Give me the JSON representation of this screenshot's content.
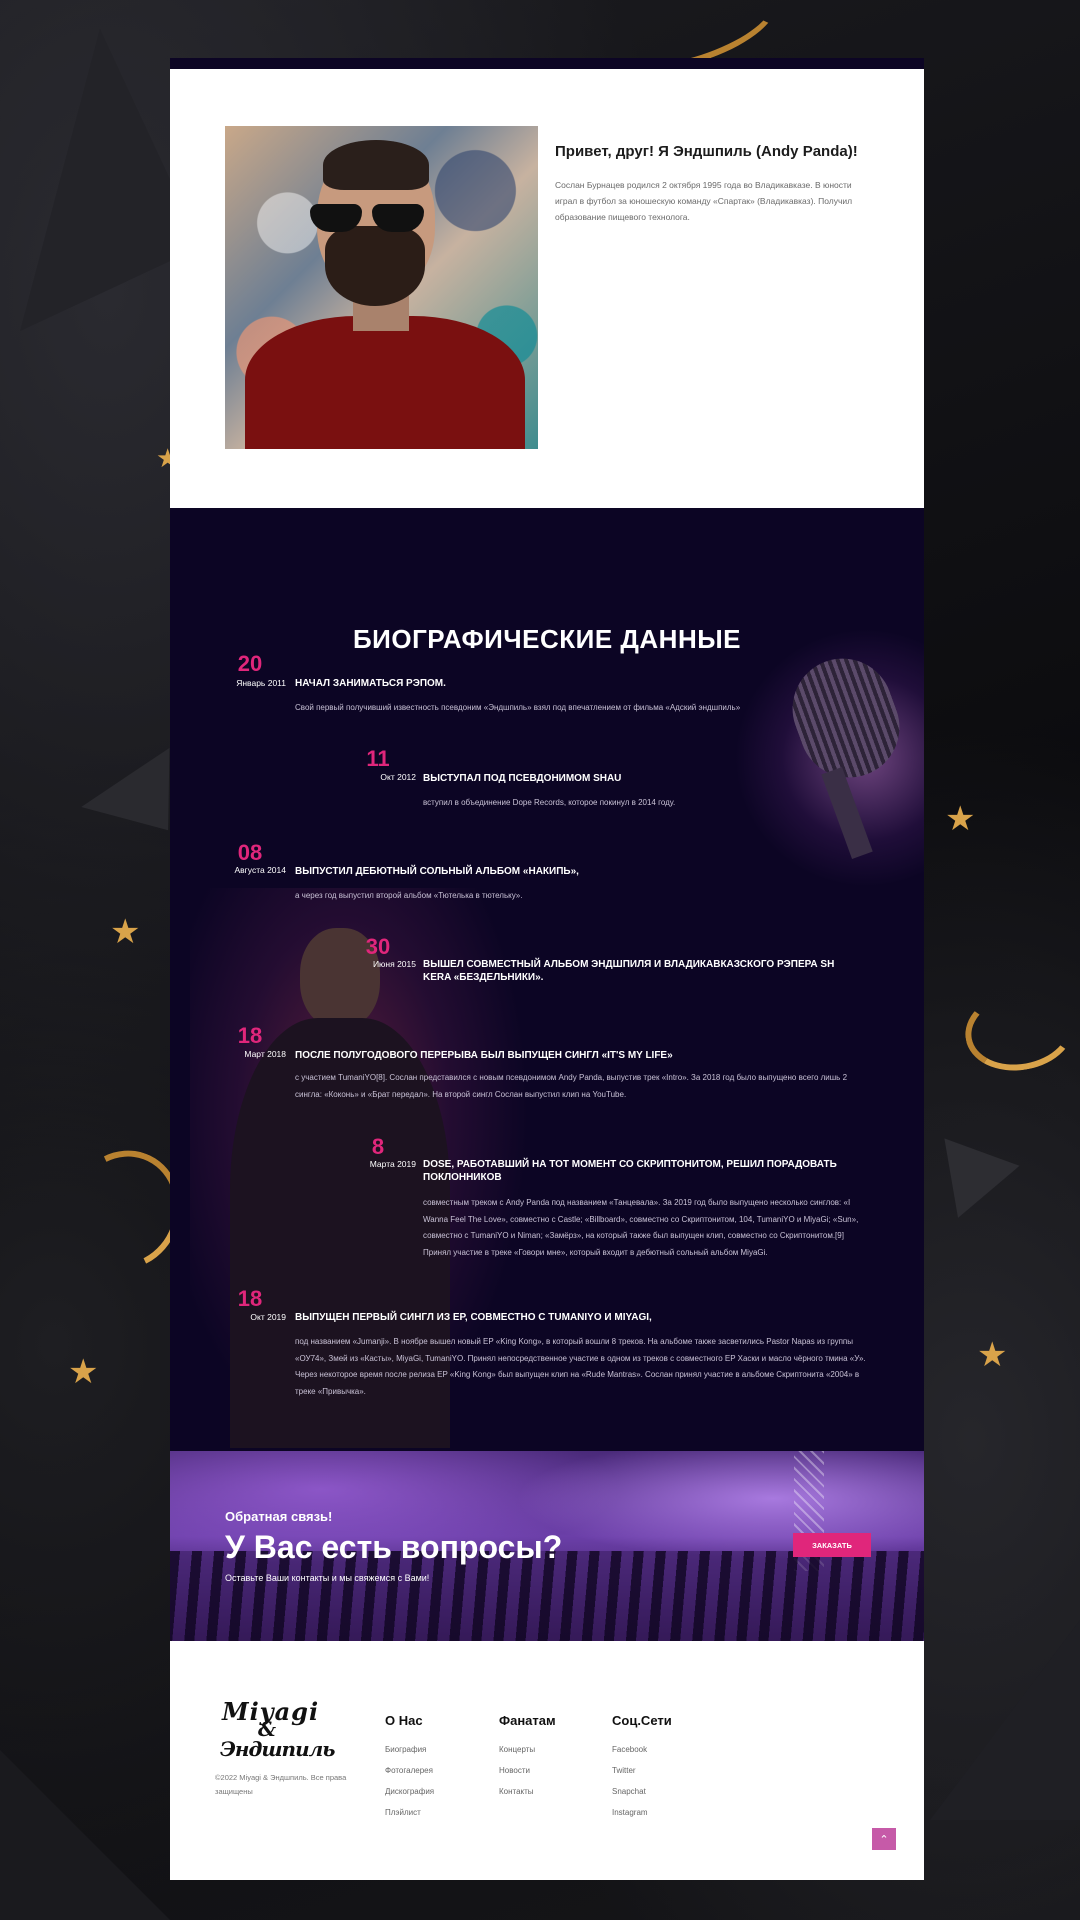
{
  "intro": {
    "title": "Привет, друг! Я Эндшпиль (Andy Panda)!",
    "text": "Сослан Бурнацев родился 2 октября 1995 года во Владикавказе. В юности играл в футбол за юношескую команду «Спартак» (Владикавказ). Получил образование пищевого технолога."
  },
  "bio": {
    "title": "БИОГРАФИЧЕСКИЕ ДАННЫЕ",
    "events": [
      {
        "day": "20",
        "month": "Январь 2011",
        "heading": "НАЧАЛ ЗАНИМАТЬСЯ РЭПОМ.",
        "desc": "Свой первый получивший известность псевдоним «Эндшпиль» взял под впечатлением от фильма «Адский эндшпиль»"
      },
      {
        "day": "11",
        "month": "Окт 2012",
        "heading": "ВЫСТУПАЛ ПОД ПСЕВДОНИМОМ SHAU",
        "desc": "вступил в объединение Dope Records, которое покинул в 2014 году."
      },
      {
        "day": "08",
        "month": "Августа 2014",
        "heading": "ВЫПУСТИЛ ДЕБЮТНЫЙ СОЛЬНЫЙ АЛЬБОМ «НАКИПЬ»,",
        "desc": "а через год выпустил второй альбом «Тютелька в тютельку»."
      },
      {
        "day": "30",
        "month": "Июня 2015",
        "heading": "ВЫШЕЛ СОВМЕСТНЫЙ АЛЬБОМ ЭНДШПИЛЯ И ВЛАДИКАВКАЗСКОГО РЭПЕРА SH KERA «БЕЗДЕЛЬНИКИ».",
        "desc": ""
      },
      {
        "day": "18",
        "month": "Март 2018",
        "heading": "ПОСЛЕ ПОЛУГОДОВОГО ПЕРЕРЫВА БЫЛ ВЫПУЩЕН СИНГЛ «IT'S MY LIFE»",
        "desc": "с участием TumaniYO[8]. Сослан представился с новым псевдонимом Andy Panda, выпустив трек «Intro». За 2018 год было выпущено всего лишь 2 сингла: «Коконь» и «Брат передал». На второй сингл Сослан выпустил клип на YouTube."
      },
      {
        "day": "8",
        "month": "Марта 2019",
        "heading": "DOSE, РАБОТАВШИЙ НА ТОТ МОМЕНТ СО СКРИПТОНИТОМ, РЕШИЛ ПОРАДОВАТЬ ПОКЛОННИКОВ",
        "desc": "совместным треком с Andy Panda под названием «Танцевала». За 2019 год было выпущено несколько синглов: «I Wanna Feel The Love», совместно с Castle; «Billboard», совместно со Скриптонитом, 104, TumaniYO и MiyaGi; «Sun», совместно с TumaniYO и Niman; «Замёрз», на который также был выпущен клип, совместно со Скриптонитом.[9] Принял участие в треке «Говори мне», который входит в дебютный сольный альбом MiyaGi."
      },
      {
        "day": "18",
        "month": "Окт 2019",
        "heading": "ВЫПУЩЕН ПЕРВЫЙ СИНГЛ ИЗ EP, СОВМЕСТНО С TUMANIYO И MIYAGI,",
        "desc": "под названием «Jumanji». В ноябре вышел новый EP «King Kong», в который вошли 8 треков. На альбоме также засветились Pastor Napas из группы «ОУ74», Змей из «Касты», MiyaGi, TumaniYO. Принял непосредственное участие в одном из треков с совместного EP Хаски и масло чёрного тмина «У». Через некоторое время после релиза EP «King Kong» был выпущен клип на «Rude Mantras». Сослан принял участие в альбоме Скриптонита «2004» в треке «Привычка»."
      }
    ]
  },
  "cta": {
    "subtitle": "Обратная связь!",
    "title": "У Вас есть вопросы?",
    "note": "Оставьте Ваши контакты и мы свяжемся с Вами!",
    "button": "ЗАКАЗАТЬ"
  },
  "footer": {
    "logo": {
      "line1": "Miyagi",
      "line2": "&",
      "line3": "Эндшпиль"
    },
    "copyright": "©2022 Miyagi & Эндшпиль. Все права защищены",
    "columns": [
      {
        "title": "О Нас",
        "links": [
          "Биография",
          "Фотогалерея",
          "Дискография",
          "Плэйлист"
        ]
      },
      {
        "title": "Фанатам",
        "links": [
          "Концерты",
          "Новости",
          "Контакты"
        ]
      },
      {
        "title": "Соц.Сети",
        "links": [
          "Facebook",
          "Twitter",
          "Snapchat",
          "Instagram"
        ]
      }
    ],
    "scroll_top_icon": "chevron-up-icon"
  },
  "colors": {
    "accent": "#e0267b",
    "dark_bg": "#0c0524",
    "star": "#d9a34a"
  }
}
